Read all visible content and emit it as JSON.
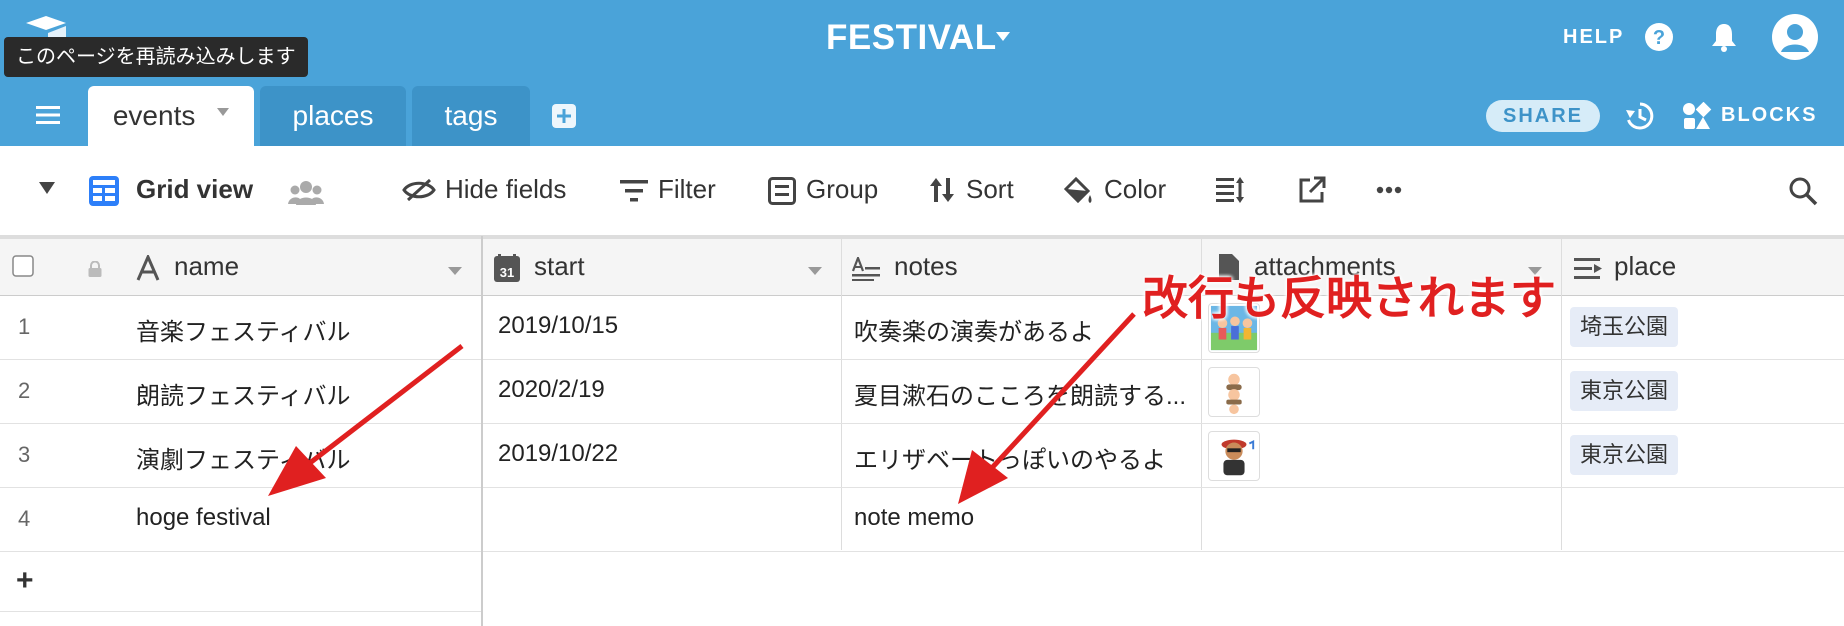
{
  "app": {
    "base_title": "FESTIVAL",
    "help_label": "HELP",
    "tooltip": "このページを再読み込みします"
  },
  "tabs": [
    {
      "label": "events",
      "active": true
    },
    {
      "label": "places",
      "active": false
    },
    {
      "label": "tags",
      "active": false
    }
  ],
  "header_right": {
    "share_label": "SHARE",
    "blocks_label": "BLOCKS"
  },
  "viewbar": {
    "view_name": "Grid view",
    "hide_fields": "Hide fields",
    "filter": "Filter",
    "group": "Group",
    "sort": "Sort",
    "color": "Color"
  },
  "columns": [
    {
      "label": "name",
      "icon": "text-icon"
    },
    {
      "label": "start",
      "icon": "calendar-icon",
      "icon_text": "31"
    },
    {
      "label": "notes",
      "icon": "long-text-icon"
    },
    {
      "label": "attachments",
      "icon": "attachment-icon"
    },
    {
      "label": "place",
      "icon": "link-icon"
    }
  ],
  "rows": [
    {
      "num": "1",
      "name": "音楽フェスティバル",
      "start": "2019/10/15",
      "notes": "吹奏楽の演奏があるよ",
      "attachment": true,
      "place": "埼玉公園"
    },
    {
      "num": "2",
      "name": "朗読フェスティバル",
      "start": "2020/2/19",
      "notes": "夏目漱石のこころを朗読する...",
      "attachment": true,
      "place": "東京公園"
    },
    {
      "num": "3",
      "name": "演劇フェスティバル",
      "start": "2019/10/22",
      "notes": "エリザベートっぽいのやるよ",
      "attachment": true,
      "place": "東京公園"
    },
    {
      "num": "4",
      "name": "hoge festival",
      "start": "",
      "notes": "note memo",
      "attachment": false,
      "place": ""
    }
  ],
  "add_row_label": "+",
  "annotation": {
    "text": "改行も反映されます",
    "color": "#e02020"
  },
  "colors": {
    "topbar": "#4aa3d9",
    "accent": "#3d93c8"
  }
}
